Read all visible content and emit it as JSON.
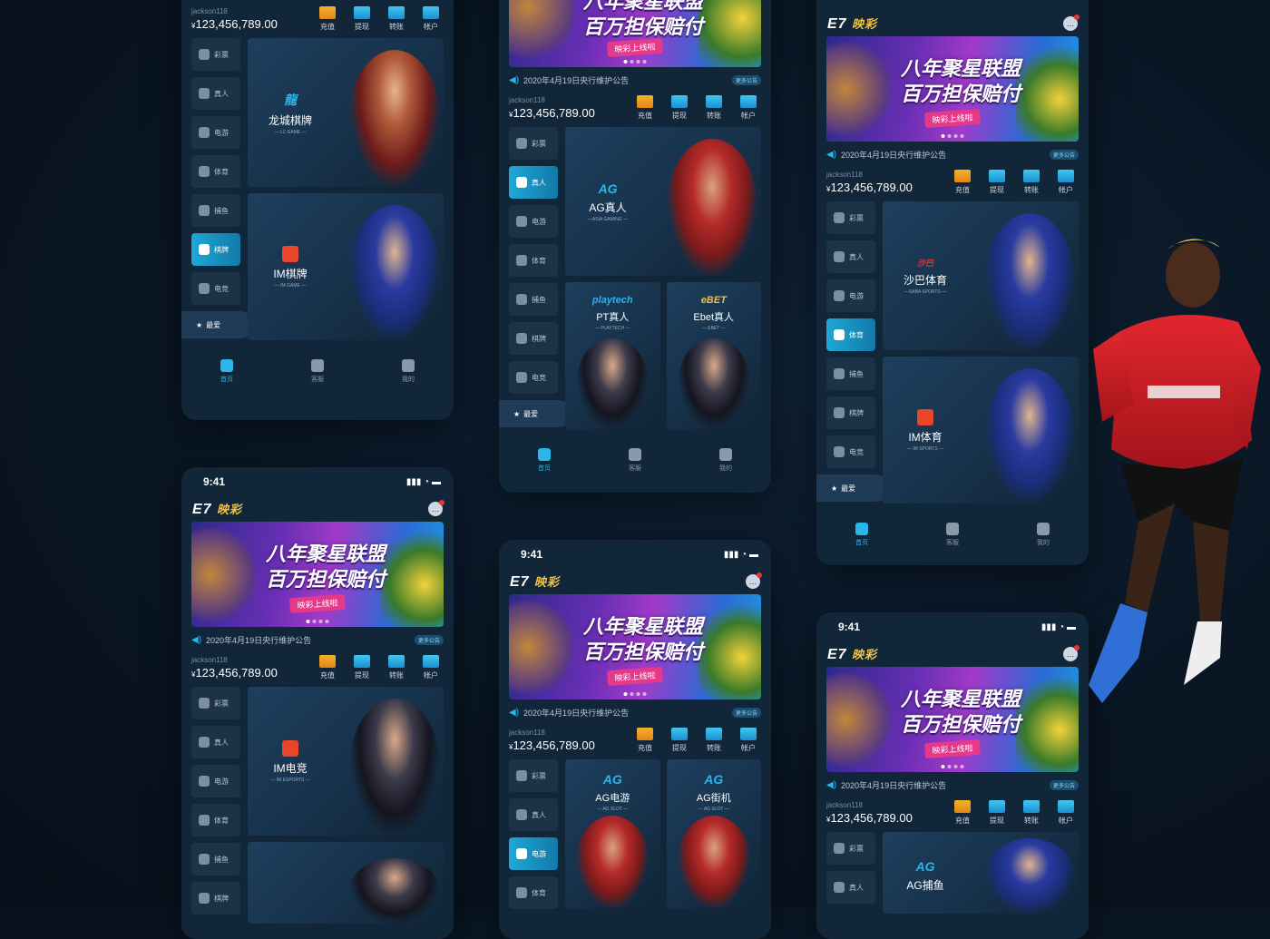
{
  "status_time": "9:41",
  "logo": {
    "mark": "E7",
    "name": "映彩"
  },
  "banner": {
    "line1": "八年聚星联盟",
    "line2": "百万担保赔付",
    "pill": "映彩上线啦"
  },
  "notice": {
    "text": "2020年4月19日央行维护公告",
    "more": "更多公告"
  },
  "account": {
    "user": "jackson118",
    "currency": "¥",
    "balance": "123,456,789.00"
  },
  "actions": [
    {
      "label": "充值",
      "icon": "deposit-icon",
      "color": "#f5b12a"
    },
    {
      "label": "提现",
      "icon": "withdraw-icon",
      "color": "#3fc8f0"
    },
    {
      "label": "转账",
      "icon": "transfer-icon",
      "color": "#3fc8f0"
    },
    {
      "label": "帐户",
      "icon": "wallet-icon",
      "color": "#3fc8f0"
    }
  ],
  "sidebar": [
    "彩票",
    "真人",
    "电游",
    "体育",
    "捕鱼",
    "棋牌",
    "电竞"
  ],
  "favorite": "最爱",
  "tabs": [
    "首页",
    "客服",
    "我的"
  ],
  "screens": {
    "chess": {
      "cards": [
        {
          "name": "龙城棋牌",
          "sub": "— LC GAME —"
        },
        {
          "name": "IM棋牌",
          "sub": "— IM GAME —"
        }
      ]
    },
    "live": {
      "cards": [
        {
          "name": "AG真人",
          "sub": "—ASIA GAMING —",
          "brand": "AG"
        },
        {
          "name": "PT真人",
          "sub": "— PLAYTECH —",
          "brand": "playtech"
        },
        {
          "name": "Ebet真人",
          "sub": "— EBET —",
          "brand": "eBET"
        }
      ]
    },
    "sports": {
      "cards": [
        {
          "name": "沙巴体育",
          "sub": "—SABA SPORTS —",
          "brand": "沙巴"
        },
        {
          "name": "IM体育",
          "sub": "— IM SPORTS —"
        }
      ]
    },
    "esports": {
      "cards": [
        {
          "name": "IM电竞",
          "sub": "— IM ESPORTS —"
        }
      ]
    },
    "slots": {
      "cards": [
        {
          "name": "AG电游",
          "sub": "— AG SLOT —",
          "brand": "AG"
        },
        {
          "name": "AG街机",
          "sub": "— AG SLOT —",
          "brand": "AG"
        }
      ]
    },
    "fishing": {
      "cards": [
        {
          "name": "AG捕鱼",
          "brand": "AG"
        }
      ]
    }
  },
  "colors": {
    "accent": "#2ab6e6",
    "background": "#0a1624",
    "panel": "#12263a"
  }
}
